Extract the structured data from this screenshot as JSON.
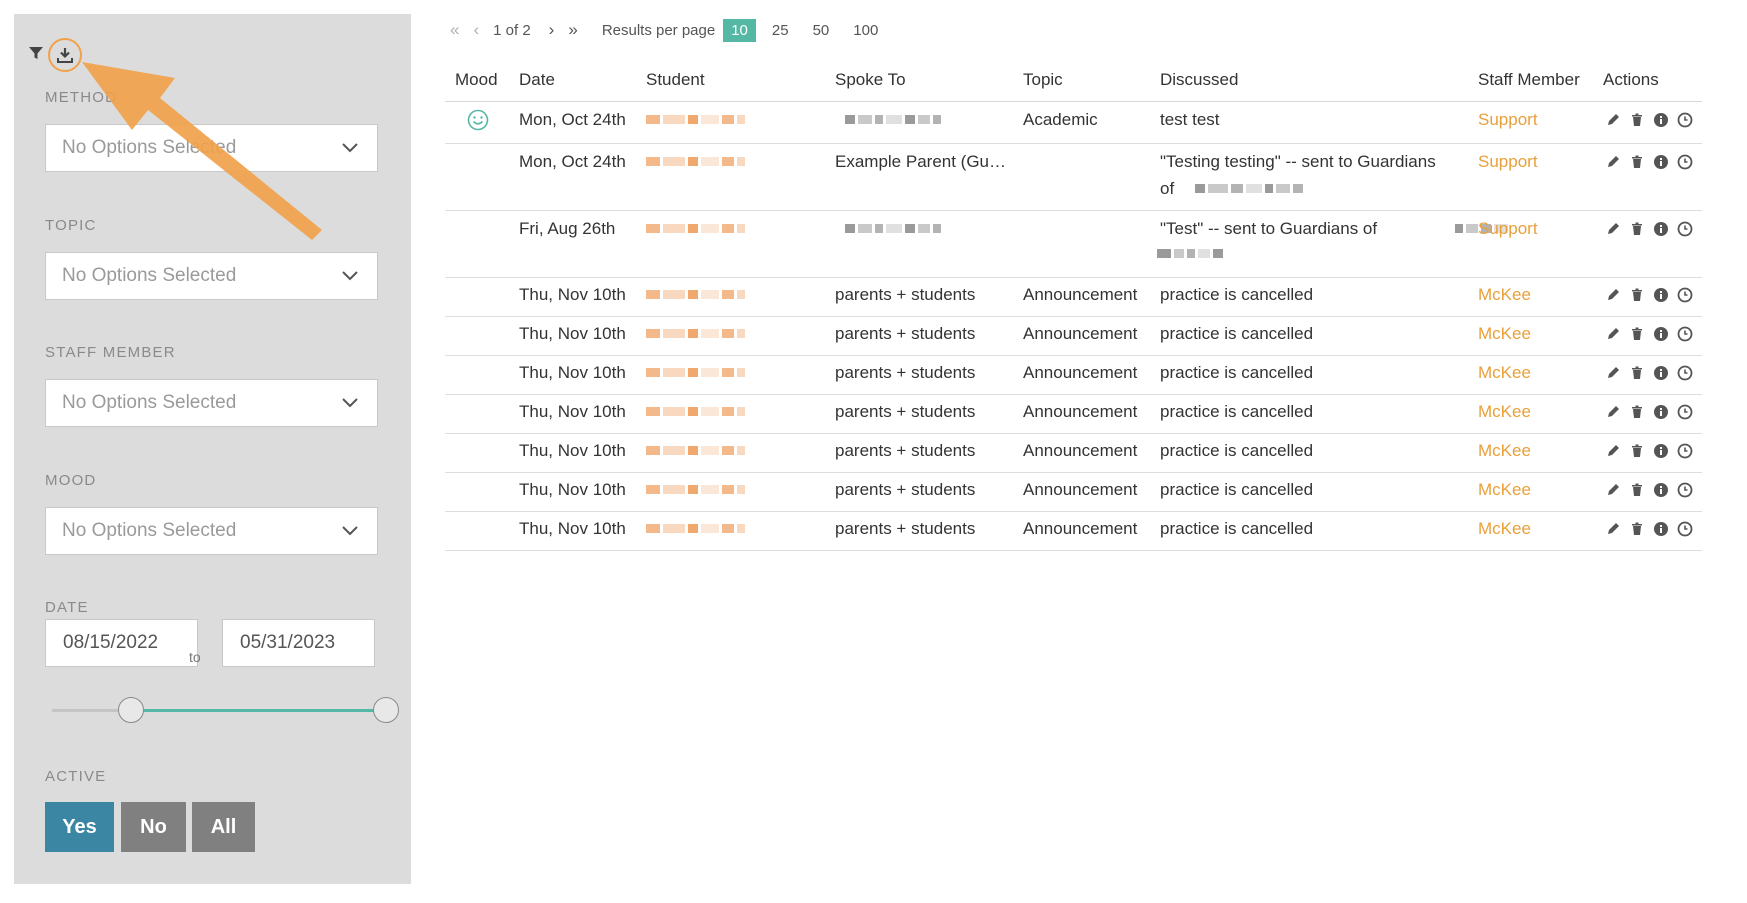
{
  "sidebar": {
    "filters": [
      {
        "label": "METHOD",
        "placeholder": "No Options Selected"
      },
      {
        "label": "TOPIC",
        "placeholder": "No Options Selected"
      },
      {
        "label": "STAFF MEMBER",
        "placeholder": "No Options Selected"
      },
      {
        "label": "MOOD",
        "placeholder": "No Options Selected"
      }
    ],
    "date": {
      "label": "DATE",
      "from": "08/15/2022",
      "to_label": "to",
      "to": "05/31/2023"
    },
    "active": {
      "label": "ACTIVE",
      "yes": "Yes",
      "no": "No",
      "all": "All"
    }
  },
  "pager": {
    "page_text": "1 of 2",
    "results_label": "Results per page",
    "options": [
      "10",
      "25",
      "50",
      "100"
    ],
    "selected": "10"
  },
  "table": {
    "headers": [
      "Mood",
      "Date",
      "Student",
      "Spoke To",
      "Topic",
      "Discussed",
      "Staff Member",
      "Actions"
    ],
    "rows": [
      {
        "date": "Mon, Oct 24th",
        "spoke_to": "",
        "topic": "Academic",
        "discussed": "test test",
        "discussed2": "",
        "staff": "Support",
        "mood": "smile-icon"
      },
      {
        "date": "Mon, Oct 24th",
        "spoke_to": "Example Parent (Gu…",
        "topic": "",
        "discussed": "\"Testing testing\" -- sent to Guardians",
        "discussed2": "of",
        "staff": "Support",
        "mood": ""
      },
      {
        "date": "Fri, Aug 26th",
        "spoke_to": "",
        "topic": "",
        "discussed": "\"Test\" -- sent to Guardians of",
        "discussed2": "",
        "staff": "Support",
        "mood": ""
      },
      {
        "date": "Thu, Nov 10th",
        "spoke_to": "parents + students",
        "topic": "Announcement",
        "discussed": "practice is cancelled",
        "discussed2": "",
        "staff": "McKee",
        "mood": ""
      },
      {
        "date": "Thu, Nov 10th",
        "spoke_to": "parents + students",
        "topic": "Announcement",
        "discussed": "practice is cancelled",
        "discussed2": "",
        "staff": "McKee",
        "mood": ""
      },
      {
        "date": "Thu, Nov 10th",
        "spoke_to": "parents + students",
        "topic": "Announcement",
        "discussed": "practice is cancelled",
        "discussed2": "",
        "staff": "McKee",
        "mood": ""
      },
      {
        "date": "Thu, Nov 10th",
        "spoke_to": "parents + students",
        "topic": "Announcement",
        "discussed": "practice is cancelled",
        "discussed2": "",
        "staff": "McKee",
        "mood": ""
      },
      {
        "date": "Thu, Nov 10th",
        "spoke_to": "parents + students",
        "topic": "Announcement",
        "discussed": "practice is cancelled",
        "discussed2": "",
        "staff": "McKee",
        "mood": ""
      },
      {
        "date": "Thu, Nov 10th",
        "spoke_to": "parents + students",
        "topic": "Announcement",
        "discussed": "practice is cancelled",
        "discussed2": "",
        "staff": "McKee",
        "mood": ""
      },
      {
        "date": "Thu, Nov 10th",
        "spoke_to": "parents + students",
        "topic": "Announcement",
        "discussed": "practice is cancelled",
        "discussed2": "",
        "staff": "McKee",
        "mood": ""
      }
    ]
  },
  "colors": {
    "accent": "#55b8a4",
    "staff": "#e9a03a",
    "yes_button": "#3b86a3",
    "arrow": "#f0a24b"
  },
  "icons": {
    "filter": "filter-icon",
    "download": "download-icon",
    "edit": "pencil-icon",
    "delete": "trash-icon",
    "info": "info-icon",
    "history": "clock-icon"
  }
}
